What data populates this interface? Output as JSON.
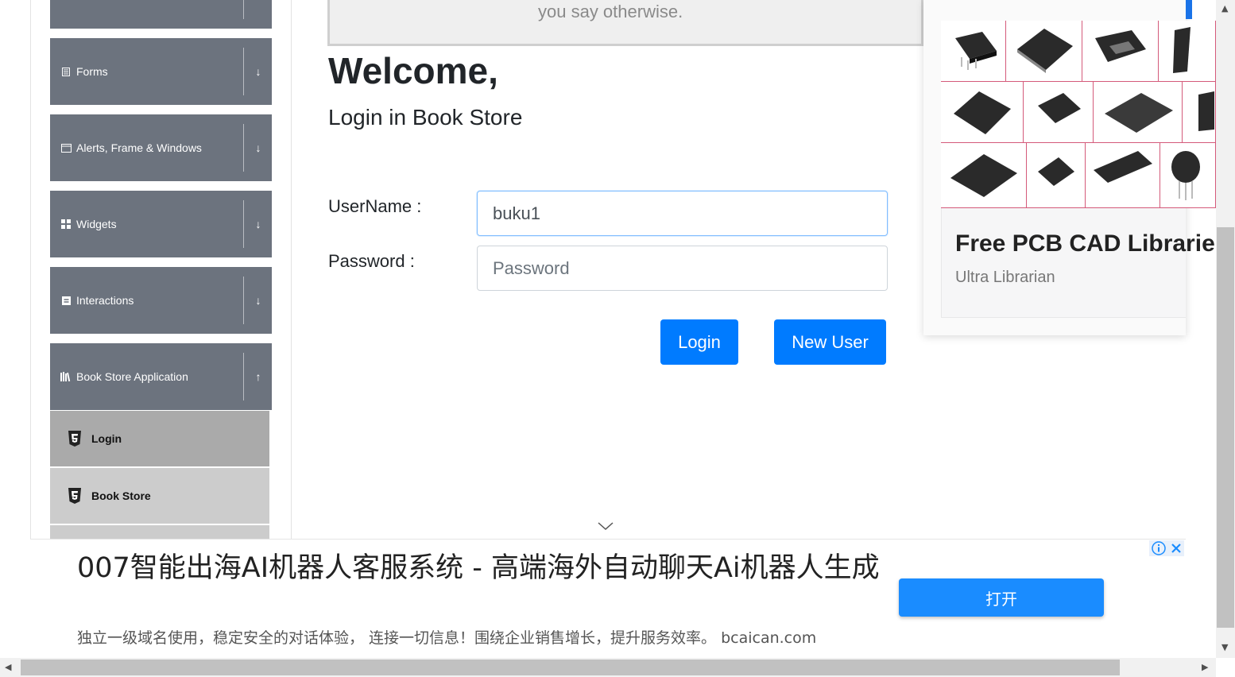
{
  "sidebar": {
    "groups": [
      {
        "label": "",
        "icon": "list-icon",
        "arrow": "↓"
      },
      {
        "label": "Forms",
        "icon": "form-icon",
        "arrow": "↓"
      },
      {
        "label": "Alerts, Frame & Windows",
        "icon": "window-icon",
        "arrow": "↓"
      },
      {
        "label": "Widgets",
        "icon": "widgets-icon",
        "arrow": "↓"
      },
      {
        "label": "Interactions",
        "icon": "interactions-icon",
        "arrow": "↓"
      },
      {
        "label": "Book Store Application",
        "icon": "books-icon",
        "arrow": "↑"
      }
    ],
    "sub_items": [
      {
        "label": "Login",
        "active": true
      },
      {
        "label": "Book Store",
        "active": false
      }
    ]
  },
  "notice": {
    "text": "you say otherwise."
  },
  "main": {
    "heading": "Welcome,",
    "subheading": "Login in Book Store",
    "username_label": "UserName :",
    "username_value": "buku1",
    "password_label": "Password :",
    "password_placeholder": "Password",
    "login_button": "Login",
    "new_user_button": "New User"
  },
  "ad_right": {
    "title": "Free PCB CAD Libraries",
    "subtitle": "Ultra Librarian"
  },
  "ad_bottom": {
    "title": "007智能出海AI机器人客服系统 - 高端海外自动聊天Ai机器人生成",
    "description": "独立一级域名使用，稳定安全的对话体验， 连接一切信息！围绕企业销售增长，提升服务效率。 bcaican.com",
    "button": "打开"
  },
  "colors": {
    "sidebar_group": "#6c737e",
    "primary": "#007bff",
    "active_sub": "#aaaaaa",
    "inactive_sub": "#cccccc"
  }
}
